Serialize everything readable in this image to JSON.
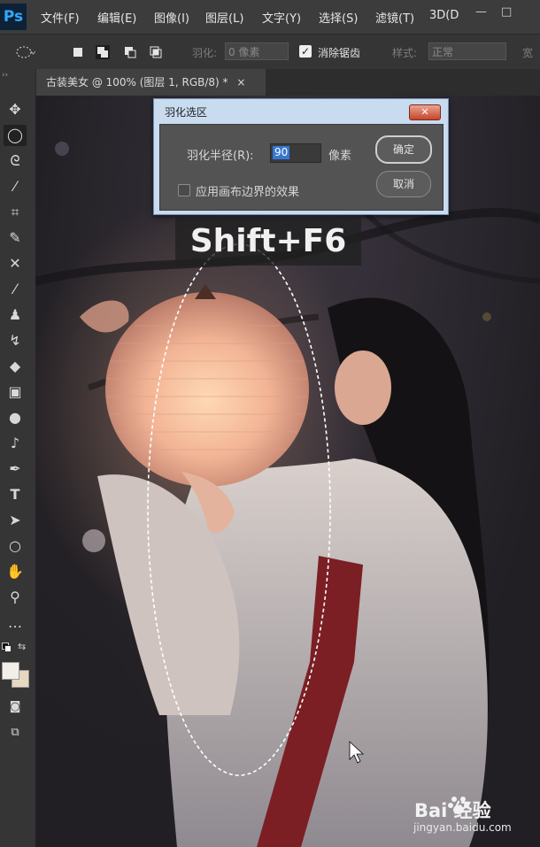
{
  "app": {
    "logo": "Ps"
  },
  "menu": [
    "文件(F)",
    "编辑(E)",
    "图像(I)",
    "图层(L)",
    "文字(Y)",
    "选择(S)",
    "滤镜(T)",
    "3D(D"
  ],
  "window_controls": [
    "—",
    "□"
  ],
  "options": {
    "feather_label": "羽化:",
    "feather_placeholder": "0 像素",
    "antialias_label": "消除锯齿",
    "style_label": "样式:",
    "style_value": "正常",
    "width_label": "宽"
  },
  "document_tab": {
    "title": "古装美女 @ 100% (图层 1, RGB/8) *",
    "close": "×"
  },
  "tools": [
    "move-tool",
    "elliptical-marquee-tool",
    "lasso-tool",
    "magic-wand-tool",
    "crop-tool",
    "eyedropper-tool",
    "healing-brush-tool",
    "brush-tool",
    "clone-stamp-tool",
    "history-brush-tool",
    "eraser-tool",
    "gradient-tool",
    "blur-tool",
    "dodge-tool",
    "pen-tool",
    "type-tool",
    "path-selection-tool",
    "ellipse-shape-tool",
    "hand-tool",
    "zoom-tool",
    "more-tools"
  ],
  "dialog": {
    "title": "羽化选区",
    "radius_label": "羽化半径(R):",
    "radius_value": "90",
    "unit": "像素",
    "checkbox_label": "应用画布边界的效果",
    "ok": "确定",
    "cancel": "取消"
  },
  "overlay": {
    "shortcut": "Shift+F6"
  },
  "watermark": {
    "brand": "Bai  经验",
    "url": "jingyan.baidu.com"
  },
  "colors": {
    "accent": "#31a8ff",
    "selection": "#3577d4",
    "dialog_title_bar": "#c9dbef"
  }
}
